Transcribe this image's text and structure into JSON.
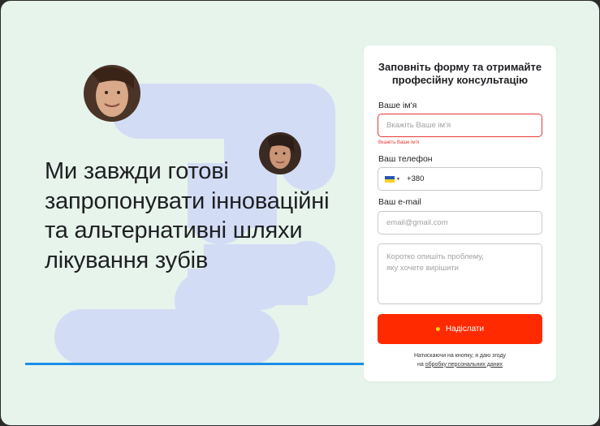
{
  "hero": {
    "headline_lines": [
      "Ми завжди готові",
      "запропонувати інноваційні",
      "та альтернативні шляхи",
      "лікування зубів"
    ]
  },
  "form": {
    "title_line1": "Заповніть форму та отримайте",
    "title_line2": "професійну консультацію",
    "name_label": "Ваше ім'я",
    "name_placeholder": "Вкажіть Ваше ім'я",
    "name_error": "Вкажіть Ваше ім'я",
    "phone_label": "Ваш телефон",
    "phone_code": "+380",
    "email_label": "Ваш e-mail",
    "email_placeholder": "email@gmail.com",
    "message_placeholder": "Коротко опишіть проблему,\nяку хочете вирішити",
    "submit_label": "Надіслати",
    "consent_line1": "Натискаючи на кнопку, я даю згоду",
    "consent_prefix": "на ",
    "consent_link": "обробку персональних даних"
  },
  "colors": {
    "background": "#e6f4ec",
    "dots": "#d3dcf5",
    "accent": "#ff2a00",
    "line": "#1a8de6",
    "error": "#e53935"
  },
  "icons": {
    "flag": "ukraine-flag-icon",
    "submit_dot": "dot-icon"
  }
}
